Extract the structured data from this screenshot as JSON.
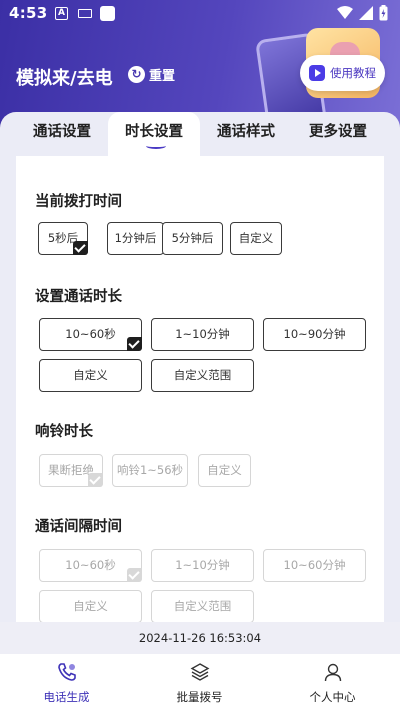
{
  "status_bar": {
    "time": "4:53",
    "a_icon": "A"
  },
  "header": {
    "title": "模拟来/去电",
    "reset_label": "重置",
    "tutorial_label": "使用教程"
  },
  "tabs": [
    {
      "label": "通话设置",
      "active": false
    },
    {
      "label": "时长设置",
      "active": true
    },
    {
      "label": "通话样式",
      "active": false
    },
    {
      "label": "更多设置",
      "active": false
    }
  ],
  "sections": {
    "dial_time": {
      "title": "当前拨打时间",
      "options": [
        "5秒后",
        "1分钟后",
        "5分钟后",
        "自定义"
      ],
      "selected": "5秒后"
    },
    "call_duration": {
      "title": "设置通话时长",
      "options": [
        "10~60秒",
        "1~10分钟",
        "10~90分钟",
        "自定义",
        "自定义范围"
      ],
      "selected": "10~60秒"
    },
    "ring_duration": {
      "title": "响铃时长",
      "options": [
        "果断拒绝",
        "响铃1~56秒",
        "自定义"
      ],
      "selected": "果断拒绝",
      "disabled": true
    },
    "call_interval": {
      "title": "通话间隔时间",
      "options": [
        "10~60秒",
        "1~10分钟",
        "10~60分钟",
        "自定义",
        "自定义范围"
      ],
      "selected": "10~60秒",
      "disabled": true
    }
  },
  "date_bar": {
    "datetime": "2024-11-26 16:53:04"
  },
  "bottom_nav": [
    {
      "label": "电话生成",
      "icon": "phone-icon",
      "active": true
    },
    {
      "label": "批量拨号",
      "icon": "layers-icon",
      "active": false
    },
    {
      "label": "个人中心",
      "icon": "user-icon",
      "active": false
    }
  ],
  "colors": {
    "header": "#4a3cb5",
    "accent": "#4a3ac4",
    "panel": "#ebecf6"
  }
}
